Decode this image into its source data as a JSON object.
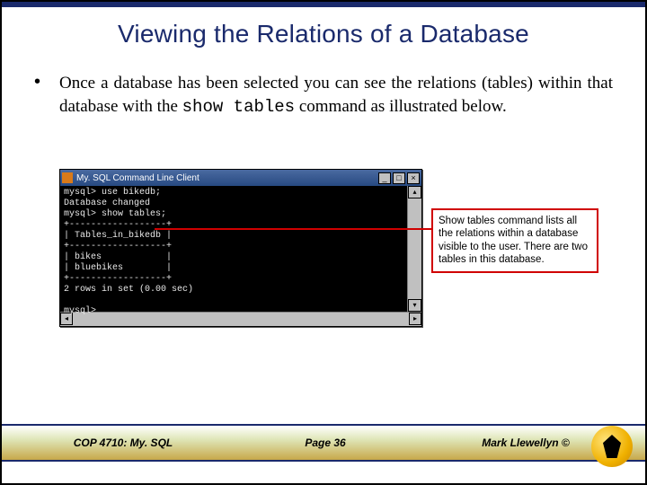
{
  "title": "Viewing the Relations of a Database",
  "bullet_char": "•",
  "body": {
    "pre": "Once a database has been selected you can see the relations (tables) within that database with the ",
    "cmd": "show tables",
    "post": " command as illustrated below."
  },
  "window": {
    "icon_name": "mysql-icon",
    "title": "My. SQL Command Line Client",
    "min": "_",
    "max": "□",
    "close": "×"
  },
  "terminal_text": "mysql> use bikedb;\nDatabase changed\nmysql> show tables;\n+------------------+\n| Tables_in_bikedb |\n+------------------+\n| bikes            |\n| bluebikes        |\n+------------------+\n2 rows in set (0.00 sec)\n\nmysql>",
  "annotation": "Show tables command lists all the relations within a database visible to the user. There are two tables in this database.",
  "footer": {
    "left": "COP 4710: My. SQL",
    "center": "Page 36",
    "right": "Mark Llewellyn ©"
  },
  "scroll": {
    "up": "▴",
    "down": "▾",
    "left": "◂",
    "right": "▸"
  }
}
